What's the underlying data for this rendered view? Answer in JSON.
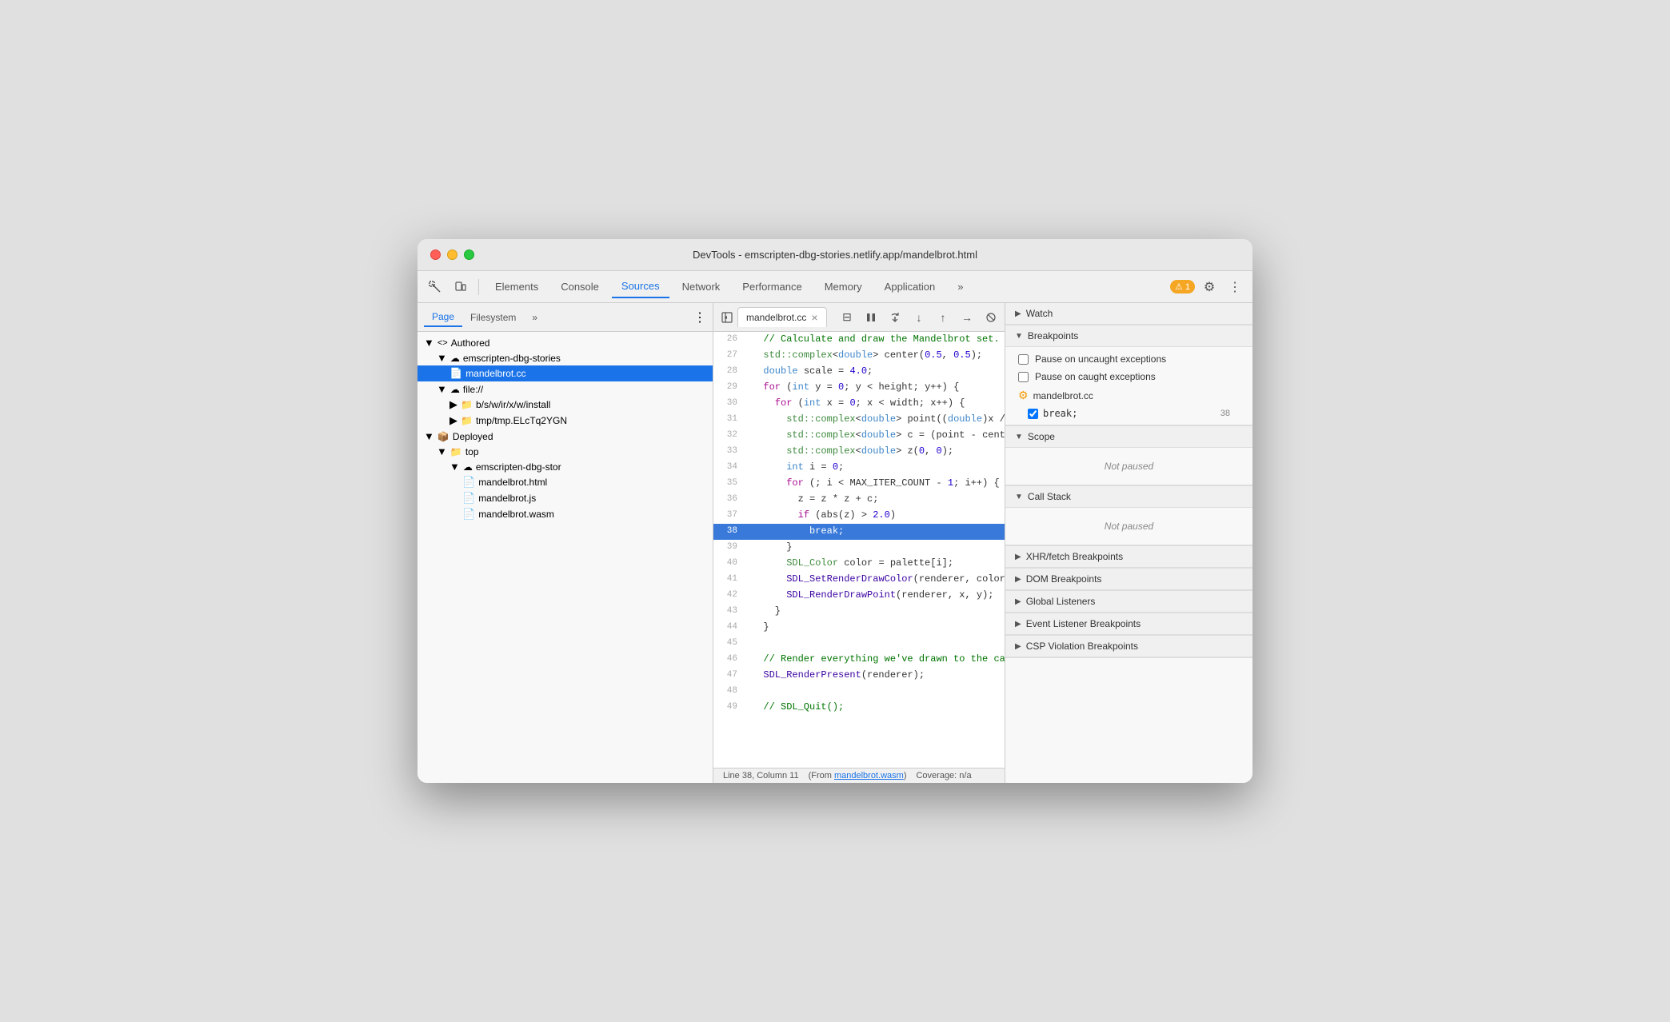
{
  "window": {
    "title": "DevTools - emscripten-dbg-stories.netlify.app/mandelbrot.html"
  },
  "toolbar": {
    "tabs": [
      "Elements",
      "Console",
      "Sources",
      "Network",
      "Performance",
      "Memory",
      "Application"
    ],
    "active_tab": "Sources",
    "warning_count": "1",
    "more_tabs_label": "»"
  },
  "left_panel": {
    "tabs": [
      "Page",
      "Filesystem",
      "»"
    ],
    "active_tab": "Page",
    "tree": [
      {
        "id": "authored",
        "label": "Authored",
        "icon": "<>",
        "indent": 0,
        "expanded": true
      },
      {
        "id": "emscripten-stories",
        "label": "emscripten-dbg-stories",
        "icon": "☁",
        "indent": 1,
        "expanded": true
      },
      {
        "id": "mandelbrot-cc",
        "label": "mandelbrot.cc",
        "icon": "📄",
        "indent": 2,
        "selected": true
      },
      {
        "id": "file",
        "label": "file://",
        "icon": "☁",
        "indent": 1,
        "expanded": true
      },
      {
        "id": "bswirxwinstall",
        "label": "b/s/w/ir/x/w/install",
        "icon": "📁",
        "indent": 2
      },
      {
        "id": "tmptmp",
        "label": "tmp/tmp.ELcTq2YGN",
        "icon": "📁",
        "indent": 2
      },
      {
        "id": "deployed",
        "label": "Deployed",
        "icon": "📦",
        "indent": 0,
        "expanded": true
      },
      {
        "id": "top",
        "label": "top",
        "icon": "📁",
        "indent": 1,
        "expanded": true
      },
      {
        "id": "emscripten-stor2",
        "label": "emscripten-dbg-stor",
        "icon": "☁",
        "indent": 2,
        "expanded": true
      },
      {
        "id": "mandelbrot-html",
        "label": "mandelbrot.html",
        "icon": "📄",
        "indent": 3
      },
      {
        "id": "mandelbrot-js",
        "label": "mandelbrot.js",
        "icon": "📄",
        "indent": 3
      },
      {
        "id": "mandelbrot-wasm",
        "label": "mandelbrot.wasm",
        "icon": "📄",
        "indent": 3
      }
    ]
  },
  "editor": {
    "tab_name": "mandelbrot.cc",
    "lines": [
      {
        "num": 26,
        "content": "  // Calculate and draw the Mandelbrot set.",
        "type": "comment"
      },
      {
        "num": 27,
        "content": "  std::complex<double> center(0.5, 0.5);",
        "type": "code"
      },
      {
        "num": 28,
        "content": "  double scale = 4.0;",
        "type": "code"
      },
      {
        "num": 29,
        "content": "  for (int y = 0; y < height; y++) {",
        "type": "code"
      },
      {
        "num": 30,
        "content": "    for (int x = 0; x < width; x++) {",
        "type": "code"
      },
      {
        "num": 31,
        "content": "      std::complex<double> point((double)x / w...",
        "type": "code"
      },
      {
        "num": 32,
        "content": "      std::complex<double> c = (point - center",
        "type": "code"
      },
      {
        "num": 33,
        "content": "      std::complex<double> z(0, 0);",
        "type": "code"
      },
      {
        "num": 34,
        "content": "      int i = 0;",
        "type": "code"
      },
      {
        "num": 35,
        "content": "      for (; i < MAX_ITER_COUNT - 1; i++) {",
        "type": "code"
      },
      {
        "num": 36,
        "content": "        z = z * z + c;",
        "type": "code"
      },
      {
        "num": 37,
        "content": "        if (abs(z) > 2.0)",
        "type": "code"
      },
      {
        "num": 38,
        "content": "          break;",
        "type": "code",
        "highlighted": true
      },
      {
        "num": 39,
        "content": "      }",
        "type": "code"
      },
      {
        "num": 40,
        "content": "      SDL_Color color = palette[i];",
        "type": "code"
      },
      {
        "num": 41,
        "content": "      SDL_SetRenderDrawColor(renderer, color.r",
        "type": "code"
      },
      {
        "num": 42,
        "content": "      SDL_RenderDrawPoint(renderer, x, y);",
        "type": "code"
      },
      {
        "num": 43,
        "content": "    }",
        "type": "code"
      },
      {
        "num": 44,
        "content": "  }",
        "type": "code"
      },
      {
        "num": 45,
        "content": "",
        "type": "empty"
      },
      {
        "num": 46,
        "content": "  // Render everything we've drawn to the canva",
        "type": "comment"
      },
      {
        "num": 47,
        "content": "  SDL_RenderPresent(renderer);",
        "type": "code"
      },
      {
        "num": 48,
        "content": "",
        "type": "empty"
      },
      {
        "num": 49,
        "content": "  // SDL_Quit();",
        "type": "comment"
      }
    ],
    "status": {
      "position": "Line 38, Column 11",
      "source": "(From mandelbrot.wasm)",
      "coverage": "Coverage: n/a"
    }
  },
  "right_panel": {
    "sections": [
      {
        "id": "watch",
        "title": "Watch",
        "expanded": false
      },
      {
        "id": "breakpoints",
        "title": "Breakpoints",
        "expanded": true,
        "checkboxes": [
          {
            "id": "pause-uncaught",
            "label": "Pause on uncaught exceptions",
            "checked": false
          },
          {
            "id": "pause-caught",
            "label": "Pause on caught exceptions",
            "checked": false
          }
        ],
        "files": [
          {
            "icon": "⚙",
            "name": "mandelbrot.cc",
            "items": [
              {
                "code": "break;",
                "line": "38",
                "checked": true
              }
            ]
          }
        ]
      },
      {
        "id": "scope",
        "title": "Scope",
        "expanded": true,
        "not_paused": "Not paused"
      },
      {
        "id": "call-stack",
        "title": "Call Stack",
        "expanded": true,
        "not_paused": "Not paused"
      },
      {
        "id": "xhr-fetch",
        "title": "XHR/fetch Breakpoints",
        "expanded": false
      },
      {
        "id": "dom-breakpoints",
        "title": "DOM Breakpoints",
        "expanded": false
      },
      {
        "id": "global-listeners",
        "title": "Global Listeners",
        "expanded": false
      },
      {
        "id": "event-listeners",
        "title": "Event Listener Breakpoints",
        "expanded": false
      },
      {
        "id": "csp-violations",
        "title": "CSP Violation Breakpoints",
        "expanded": false
      }
    ]
  },
  "debug_controls": {
    "pause_label": "⏸",
    "step_over": "↷",
    "step_into": "↓",
    "step_out": "↑",
    "continue": "→",
    "deactivate": "⊘"
  }
}
